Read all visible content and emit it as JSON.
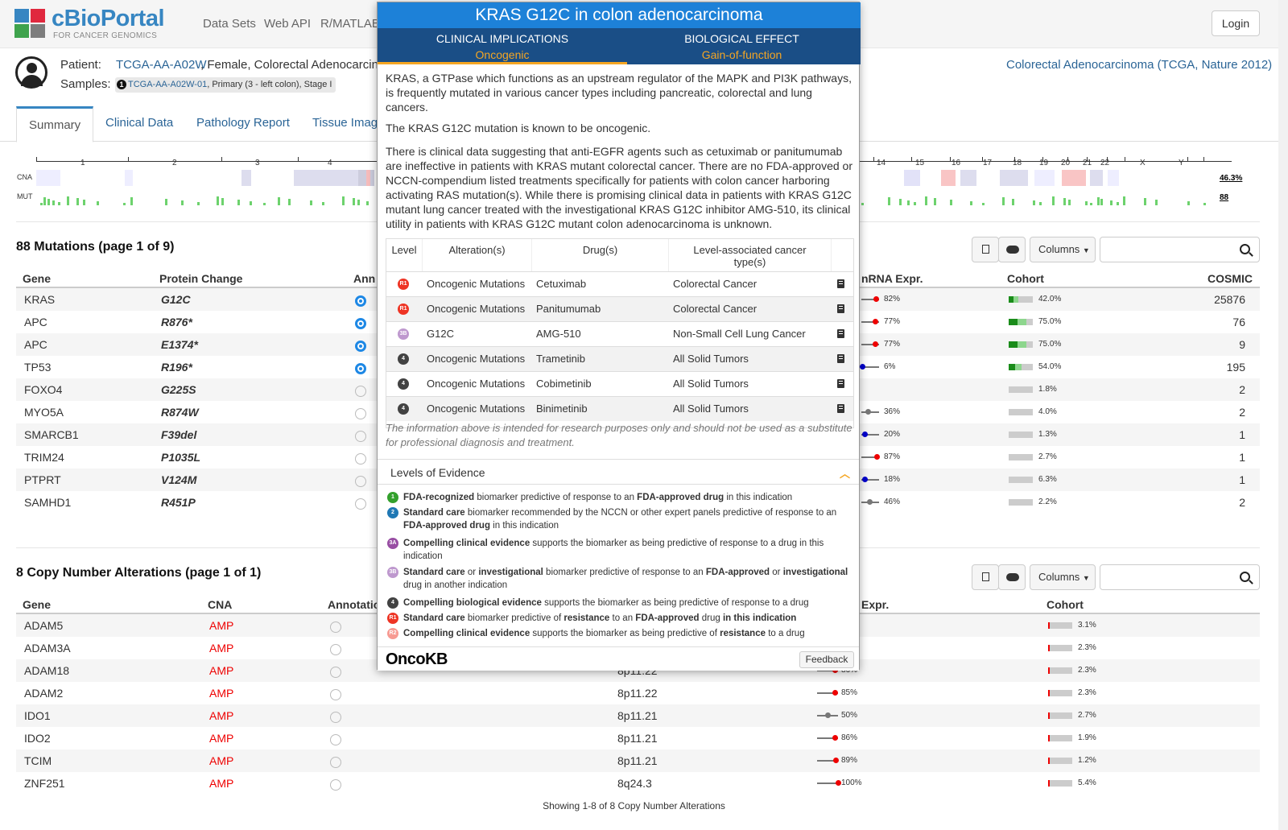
{
  "brand": {
    "name": "cBioPortal",
    "tagline": "FOR CANCER GENOMICS"
  },
  "nav": [
    "Data Sets",
    "Web API",
    "R/MATLAB"
  ],
  "login": "Login",
  "patient": {
    "label": "Patient:",
    "id": "TCGA-AA-A02W",
    "desc": ", Female, Colorectal Adenocarcino",
    "samples_label": "Samples:",
    "sample_id": "TCGA-AA-A02W-01",
    "sample_desc": ", Primary (3 - left colon), Stage I",
    "study": "Colorectal Adenocarcinoma (TCGA, Nature 2012)"
  },
  "tabs": [
    "Summary",
    "Clinical Data",
    "Pathology Report",
    "Tissue Image"
  ],
  "genome": {
    "chromosomes": [
      "1",
      "2",
      "3",
      "4",
      "14",
      "15",
      "16",
      "17",
      "18",
      "19",
      "20",
      "21",
      "22",
      "X",
      "Y"
    ],
    "cna_label": "CNA",
    "mut_label": "MUT",
    "cna_pct": "46.3%",
    "mut_count": "88"
  },
  "mutations": {
    "title": "88 Mutations (page 1 of 9)",
    "columns": [
      "Gene",
      "Protein Change",
      "Ann",
      "nRNA Expr.",
      "Cohort",
      "COSMIC"
    ],
    "rows": [
      {
        "gene": "KRAS",
        "protein": "G12C",
        "ann": true,
        "mrna": "82%",
        "mrna_val": 0.82,
        "cohort": "42.0%",
        "cohort_val": 0.42,
        "cosmic": "25876"
      },
      {
        "gene": "APC",
        "protein": "R876*",
        "ann": true,
        "mrna": "77%",
        "mrna_val": 0.77,
        "cohort": "75.0%",
        "cohort_val": 0.75,
        "cosmic": "76"
      },
      {
        "gene": "APC",
        "protein": "E1374*",
        "ann": true,
        "mrna": "77%",
        "mrna_val": 0.77,
        "cohort": "75.0%",
        "cohort_val": 0.75,
        "cosmic": "9"
      },
      {
        "gene": "TP53",
        "protein": "R196*",
        "ann": true,
        "mrna": "6%",
        "mrna_val": 0.06,
        "cohort": "54.0%",
        "cohort_val": 0.54,
        "cosmic": "195"
      },
      {
        "gene": "FOXO4",
        "protein": "G225S",
        "ann": false,
        "mrna": "",
        "mrna_val": null,
        "cohort": "1.8%",
        "cohort_val": 0.018,
        "cosmic": "2"
      },
      {
        "gene": "MYO5A",
        "protein": "R874W",
        "ann": false,
        "mrna": "36%",
        "mrna_val": 0.36,
        "cohort": "4.0%",
        "cohort_val": 0.04,
        "cosmic": "2"
      },
      {
        "gene": "SMARCB1",
        "protein": "F39del",
        "ann": false,
        "mrna": "20%",
        "mrna_val": 0.2,
        "cohort": "1.3%",
        "cohort_val": 0.013,
        "cosmic": "1"
      },
      {
        "gene": "TRIM24",
        "protein": "P1035L",
        "ann": false,
        "mrna": "87%",
        "mrna_val": 0.87,
        "cohort": "2.7%",
        "cohort_val": 0.027,
        "cosmic": "1"
      },
      {
        "gene": "PTPRT",
        "protein": "V124M",
        "ann": false,
        "mrna": "18%",
        "mrna_val": 0.18,
        "cohort": "6.3%",
        "cohort_val": 0.063,
        "cosmic": "1"
      },
      {
        "gene": "SAMHD1",
        "protein": "R451P",
        "ann": false,
        "mrna": "46%",
        "mrna_val": 0.46,
        "cohort": "2.2%",
        "cohort_val": 0.022,
        "cosmic": "2"
      }
    ]
  },
  "toolbar": {
    "columns": "Columns"
  },
  "cna": {
    "title": "8 Copy Number Alterations (page 1 of 1)",
    "columns": [
      "Gene",
      "CNA",
      "Annotatio",
      "Expr.",
      "Cohort"
    ],
    "rows": [
      {
        "gene": "ADAM5",
        "cna": "AMP",
        "cyto": "",
        "mrna": "",
        "mrna_val": null,
        "cohort": "3.1%"
      },
      {
        "gene": "ADAM3A",
        "cna": "AMP",
        "cyto": "",
        "mrna": "",
        "mrna_val": null,
        "cohort": "2.3%"
      },
      {
        "gene": "ADAM18",
        "cna": "AMP",
        "cyto": "8p11.22",
        "mrna": "86%",
        "mrna_val": 0.86,
        "cohort": "2.3%"
      },
      {
        "gene": "ADAM2",
        "cna": "AMP",
        "cyto": "8p11.22",
        "mrna": "85%",
        "mrna_val": 0.85,
        "cohort": "2.3%"
      },
      {
        "gene": "IDO1",
        "cna": "AMP",
        "cyto": "8p11.21",
        "mrna": "50%",
        "mrna_val": 0.5,
        "cohort": "2.7%"
      },
      {
        "gene": "IDO2",
        "cna": "AMP",
        "cyto": "8p11.21",
        "mrna": "86%",
        "mrna_val": 0.86,
        "cohort": "1.9%"
      },
      {
        "gene": "TCIM",
        "cna": "AMP",
        "cyto": "8p11.21",
        "mrna": "89%",
        "mrna_val": 0.89,
        "cohort": "1.2%"
      },
      {
        "gene": "ZNF251",
        "cna": "AMP",
        "cyto": "8q24.3",
        "mrna": "100%",
        "mrna_val": 1.0,
        "cohort": "5.4%"
      }
    ],
    "footer": "Showing 1-8 of 8 Copy Number Alterations"
  },
  "popup": {
    "title": "KRAS G12C in colon adenocarcinoma",
    "tab1": {
      "h": "CLINICAL IMPLICATIONS",
      "v": "Oncogenic"
    },
    "tab2": {
      "h": "BIOLOGICAL EFFECT",
      "v": "Gain-of-function"
    },
    "p1": "KRAS, a GTPase which functions as an upstream regulator of the MAPK and PI3K pathways, is frequently mutated in various cancer types including pancreatic, colorectal and lung cancers.",
    "p2": "The KRAS G12C mutation is known to be oncogenic.",
    "p3": "There is clinical data suggesting that anti-EGFR agents such as cetuximab or panitumumab are ineffective in patients with KRAS mutant colorectal cancer. There are no FDA-approved or NCCN-compendium listed treatments specifically for patients with colon cancer harboring activating RAS mutation(s). While there is promising clinical data in patients with KRAS G12C mutant lung cancer treated with the investigational KRAS G12C inhibitor AMG-510, its clinical utility in patients with KRAS G12C mutant colon adenocarcinoma is unknown.",
    "table_headers": [
      "Level",
      "Alteration(s)",
      "Drug(s)",
      "Level-associated cancer type(s)"
    ],
    "rows": [
      {
        "level": "R1",
        "alt": "Oncogenic Mutations",
        "drug": "Cetuximab",
        "cancer": "Colorectal Cancer"
      },
      {
        "level": "R1",
        "alt": "Oncogenic Mutations",
        "drug": "Panitumumab",
        "cancer": "Colorectal Cancer"
      },
      {
        "level": "3B",
        "alt": "G12C",
        "drug": "AMG-510",
        "cancer": "Non-Small Cell Lung Cancer"
      },
      {
        "level": "4",
        "alt": "Oncogenic Mutations",
        "drug": "Trametinib",
        "cancer": "All Solid Tumors"
      },
      {
        "level": "4",
        "alt": "Oncogenic Mutations",
        "drug": "Cobimetinib",
        "cancer": "All Solid Tumors"
      },
      {
        "level": "4",
        "alt": "Oncogenic Mutations",
        "drug": "Binimetinib",
        "cancer": "All Solid Tumors"
      }
    ],
    "disclaimer": "The information above is intended for research purposes only and should not be used as a substitute for professional diagnosis and treatment.",
    "loe_title": "Levels of Evidence",
    "loe": [
      {
        "lvl": "1",
        "color": "#33a02c",
        "html": "<b>FDA-recognized</b> biomarker predictive of response to an <b>FDA-approved drug</b> in this indication"
      },
      {
        "lvl": "2",
        "color": "#1f78b4",
        "html": "<b>Standard care</b> biomarker recommended by the NCCN or other expert panels predictive of response to an <b>FDA-approved drug</b> in this indication"
      },
      {
        "lvl": "3A",
        "color": "#984ea3",
        "html": "<b>Compelling clinical evidence</b> supports the biomarker as being predictive of response to a drug in this indication"
      },
      {
        "lvl": "3B",
        "color": "#be98ce",
        "html": "<b>Standard care</b> or <b>investigational</b> biomarker predictive of response to an <b>FDA-approved</b> or <b>investigational</b> drug in another indication"
      },
      {
        "lvl": "4",
        "color": "#424242",
        "html": "<b>Compelling biological evidence</b> supports the biomarker as being predictive of response to a drug"
      },
      {
        "lvl": "R1",
        "color": "#ee3424",
        "html": "<b>Standard care</b> biomarker predictive of <b>resistance</b> to an <b>FDA-approved</b> drug <b>in this indication</b>"
      },
      {
        "lvl": "R2",
        "color": "#f79a92",
        "html": "<b>Compelling clinical evidence</b> supports the biomarker as being predictive of <b>resistance</b> to a drug"
      }
    ],
    "footer_logo": "OncoKB",
    "feedback": "Feedback"
  }
}
